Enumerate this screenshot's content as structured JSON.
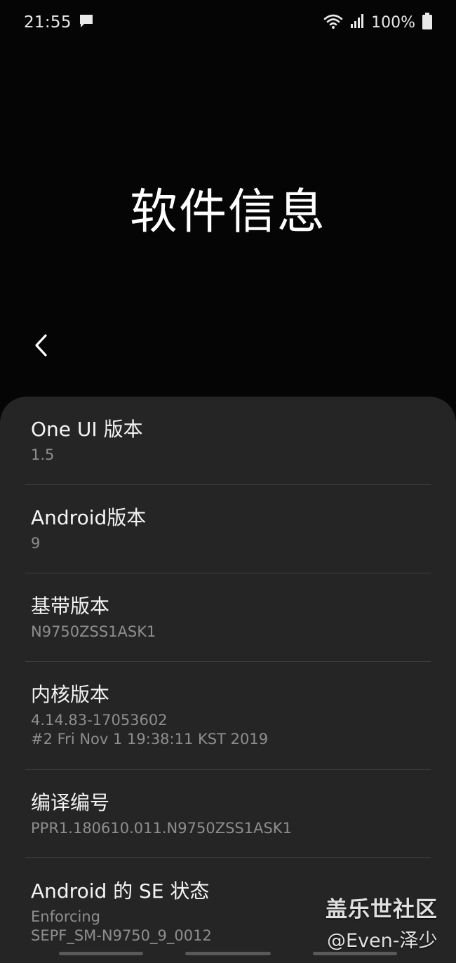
{
  "status_bar": {
    "time": "21:55",
    "battery": "100%",
    "icons": [
      "message-icon",
      "wifi-icon",
      "signal-icon",
      "battery-icon"
    ]
  },
  "header": {
    "title": "软件信息"
  },
  "items": [
    {
      "title": "One UI 版本",
      "values": [
        "1.5"
      ]
    },
    {
      "title": "Android版本",
      "values": [
        "9"
      ]
    },
    {
      "title": "基带版本",
      "values": [
        "N9750ZSS1ASK1"
      ]
    },
    {
      "title": "内核版本",
      "values": [
        "4.14.83-17053602",
        "#2 Fri Nov 1 19:38:11 KST 2019"
      ]
    },
    {
      "title": "编译编号",
      "values": [
        "PPR1.180610.011.N9750ZSS1ASK1"
      ]
    },
    {
      "title": "Android 的 SE 状态",
      "values": [
        "Enforcing",
        "SEPF_SM-N9750_9_0012"
      ]
    }
  ],
  "watermark": {
    "line1": "盖乐世社区",
    "line2": "@Even-泽少"
  },
  "colors": {
    "background": "#050505",
    "card": "#252525",
    "divider": "#3d3d3d",
    "value_text": "#8e8e8e"
  }
}
